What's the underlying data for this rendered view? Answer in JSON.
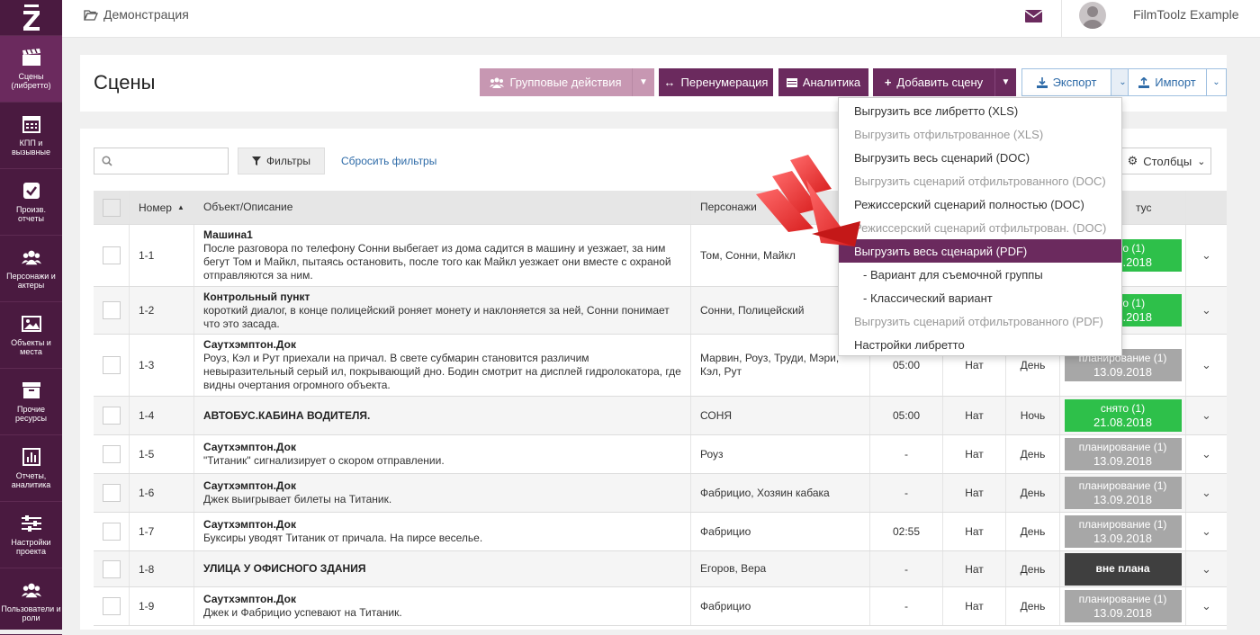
{
  "nav": {
    "items": [
      {
        "label": "Сцены\n(либретто)",
        "icon": "clapperboard-icon"
      },
      {
        "label": "КПП и\nвызывные",
        "icon": "calendar-icon"
      },
      {
        "label": "Произв.\nотчеты",
        "icon": "checkbox-icon"
      },
      {
        "label": "Персонажи и\nактеры",
        "icon": "people-icon"
      },
      {
        "label": "Объекты и\nместа",
        "icon": "image-icon"
      },
      {
        "label": "Прочие\nресурсы",
        "icon": "box-icon"
      },
      {
        "label": "Отчеты,\nаналитика",
        "icon": "bar-chart-icon"
      },
      {
        "label": "Настройки\nпроекта",
        "icon": "sliders-icon"
      },
      {
        "label": "Пользователи и\nроли",
        "icon": "users-icon"
      }
    ]
  },
  "topbar": {
    "breadcrumb": "Демонстрация",
    "username": "FilmToolz Example"
  },
  "header": {
    "title": "Сцены",
    "group_actions": "Групповые действия",
    "renumber": "Перенумерация",
    "analytics": "Аналитика",
    "add_scene": "Добавить сцену",
    "export": "Экспорт",
    "import": "Импорт"
  },
  "toolbar": {
    "search_placeholder": "",
    "filters": "Фильтры",
    "reset_filters": "Сбросить фильтры",
    "columns": "Столбцы"
  },
  "table": {
    "headers": {
      "number": "Номер",
      "object": "Объект/Описание",
      "characters": "Персонажи",
      "status": "тус"
    },
    "rows": [
      {
        "num": "1-1",
        "title": "Машина1",
        "desc": "После разговора по телефону Сонни выбегает из дома садится в машину и уезжает, за ним бегут Том и Майкл, пытаясь остановить, после того как Майкл уезжает они вместе с охраной отправляются за ним.",
        "chars": "Том, Сонни, Майкл",
        "time": "",
        "nat": "",
        "day": "",
        "status1": "снято (1)",
        "status2": "21.08.2018",
        "status_color": "green"
      },
      {
        "num": "1-2",
        "title": "Контрольный пункт",
        "desc": "короткий диалог, в конце полицейский роняет монету и наклоняется за ней, Сонни понимает что это засада.",
        "chars": "Сонни, Полицейский",
        "time": "",
        "nat": "",
        "day": "",
        "status1": "снято (1)",
        "status2": "21.08.2018",
        "status_color": "green"
      },
      {
        "num": "1-3",
        "title": "Саутхэмптон.Док",
        "desc": "Роуз, Кэл и Рут приехали на причал. В свете субмарин становится различим невыразительный серый ил, покрывающий дно. Бодин смотрит на дисплей гидролокатора, где видны очертания огромного объекта.",
        "chars": "Марвин, Роуз, Труди, Мэри, Кэл, Рут",
        "time": "05:00",
        "nat": "Нат",
        "day": "День",
        "status1": "планирование (1)",
        "status2": "13.09.2018",
        "status_color": "grey"
      },
      {
        "num": "1-4",
        "title": "АВТОБУС.КАБИНА ВОДИТЕЛЯ.",
        "desc": "",
        "chars": "СОНЯ",
        "time": "05:00",
        "nat": "Нат",
        "day": "Ночь",
        "status1": "снято (1)",
        "status2": "21.08.2018",
        "status_color": "green"
      },
      {
        "num": "1-5",
        "title": "Саутхэмптон.Док",
        "desc": "\"Титаник\" сигнализирует о скором отправлении.",
        "chars": "Роуз",
        "time": "-",
        "nat": "Нат",
        "day": "День",
        "status1": "планирование (1)",
        "status2": "13.09.2018",
        "status_color": "grey"
      },
      {
        "num": "1-6",
        "title": "Саутхэмптон.Док",
        "desc": "Джек выигрывает билеты на Титаник.",
        "chars": "Фабрицио, Хозяин кабака",
        "time": "-",
        "nat": "Нат",
        "day": "День",
        "status1": "планирование (1)",
        "status2": "13.09.2018",
        "status_color": "grey"
      },
      {
        "num": "1-7",
        "title": "Саутхэмптон.Док",
        "desc": "Буксиры уводят Титаник от причала. На пирсе веселье.",
        "chars": "Фабрицио",
        "time": "02:55",
        "nat": "Нат",
        "day": "День",
        "status1": "планирование (1)",
        "status2": "13.09.2018",
        "status_color": "grey"
      },
      {
        "num": "1-8",
        "title": "УЛИЦА У ОФИСНОГО ЗДАНИЯ",
        "desc": "",
        "chars": "Егоров, Вера",
        "time": "-",
        "nat": "Нат",
        "day": "День",
        "status1": "вне плана",
        "status2": "",
        "status_color": "dark"
      },
      {
        "num": "1-9",
        "title": "Саутхэмптон.Док",
        "desc": "Джек и Фабрицио успевают на Титаник.",
        "chars": "Фабрицио",
        "time": "-",
        "nat": "Нат",
        "day": "День",
        "status1": "планирование (1)",
        "status2": "13.09.2018",
        "status_color": "grey"
      }
    ]
  },
  "export_menu": {
    "items": [
      {
        "label": "Выгрузить все либретто (XLS)",
        "state": "normal"
      },
      {
        "label": "Выгрузить отфильтрованное (XLS)",
        "state": "disabled"
      },
      {
        "label": "Выгрузить весь сценарий (DOC)",
        "state": "normal"
      },
      {
        "label": "Выгрузить сценарий отфильтрованного (DOC)",
        "state": "disabled"
      },
      {
        "label": "Режиссерский сценарий полностью (DOC)",
        "state": "normal"
      },
      {
        "label": "Режиссерский сценарий отфильтрован. (DOC)",
        "state": "disabled"
      },
      {
        "label": "Выгрузить весь сценарий (PDF)",
        "state": "highlighted"
      },
      {
        "label": "- Вариант для съемочной группы",
        "state": "sub"
      },
      {
        "label": "- Классический вариант",
        "state": "sub"
      },
      {
        "label": "Выгрузить сценарий отфильтрованного (PDF)",
        "state": "disabled"
      },
      {
        "label": "Настройки либретто",
        "state": "normal"
      }
    ]
  },
  "colors": {
    "brand": "#6b2a5e",
    "rail": "#4a1a40",
    "link": "#2e6ba8",
    "shot": "#2ec04a",
    "planning": "#a7a7a7",
    "unplanned": "#3f3f3f",
    "arrow": "#e02424"
  }
}
